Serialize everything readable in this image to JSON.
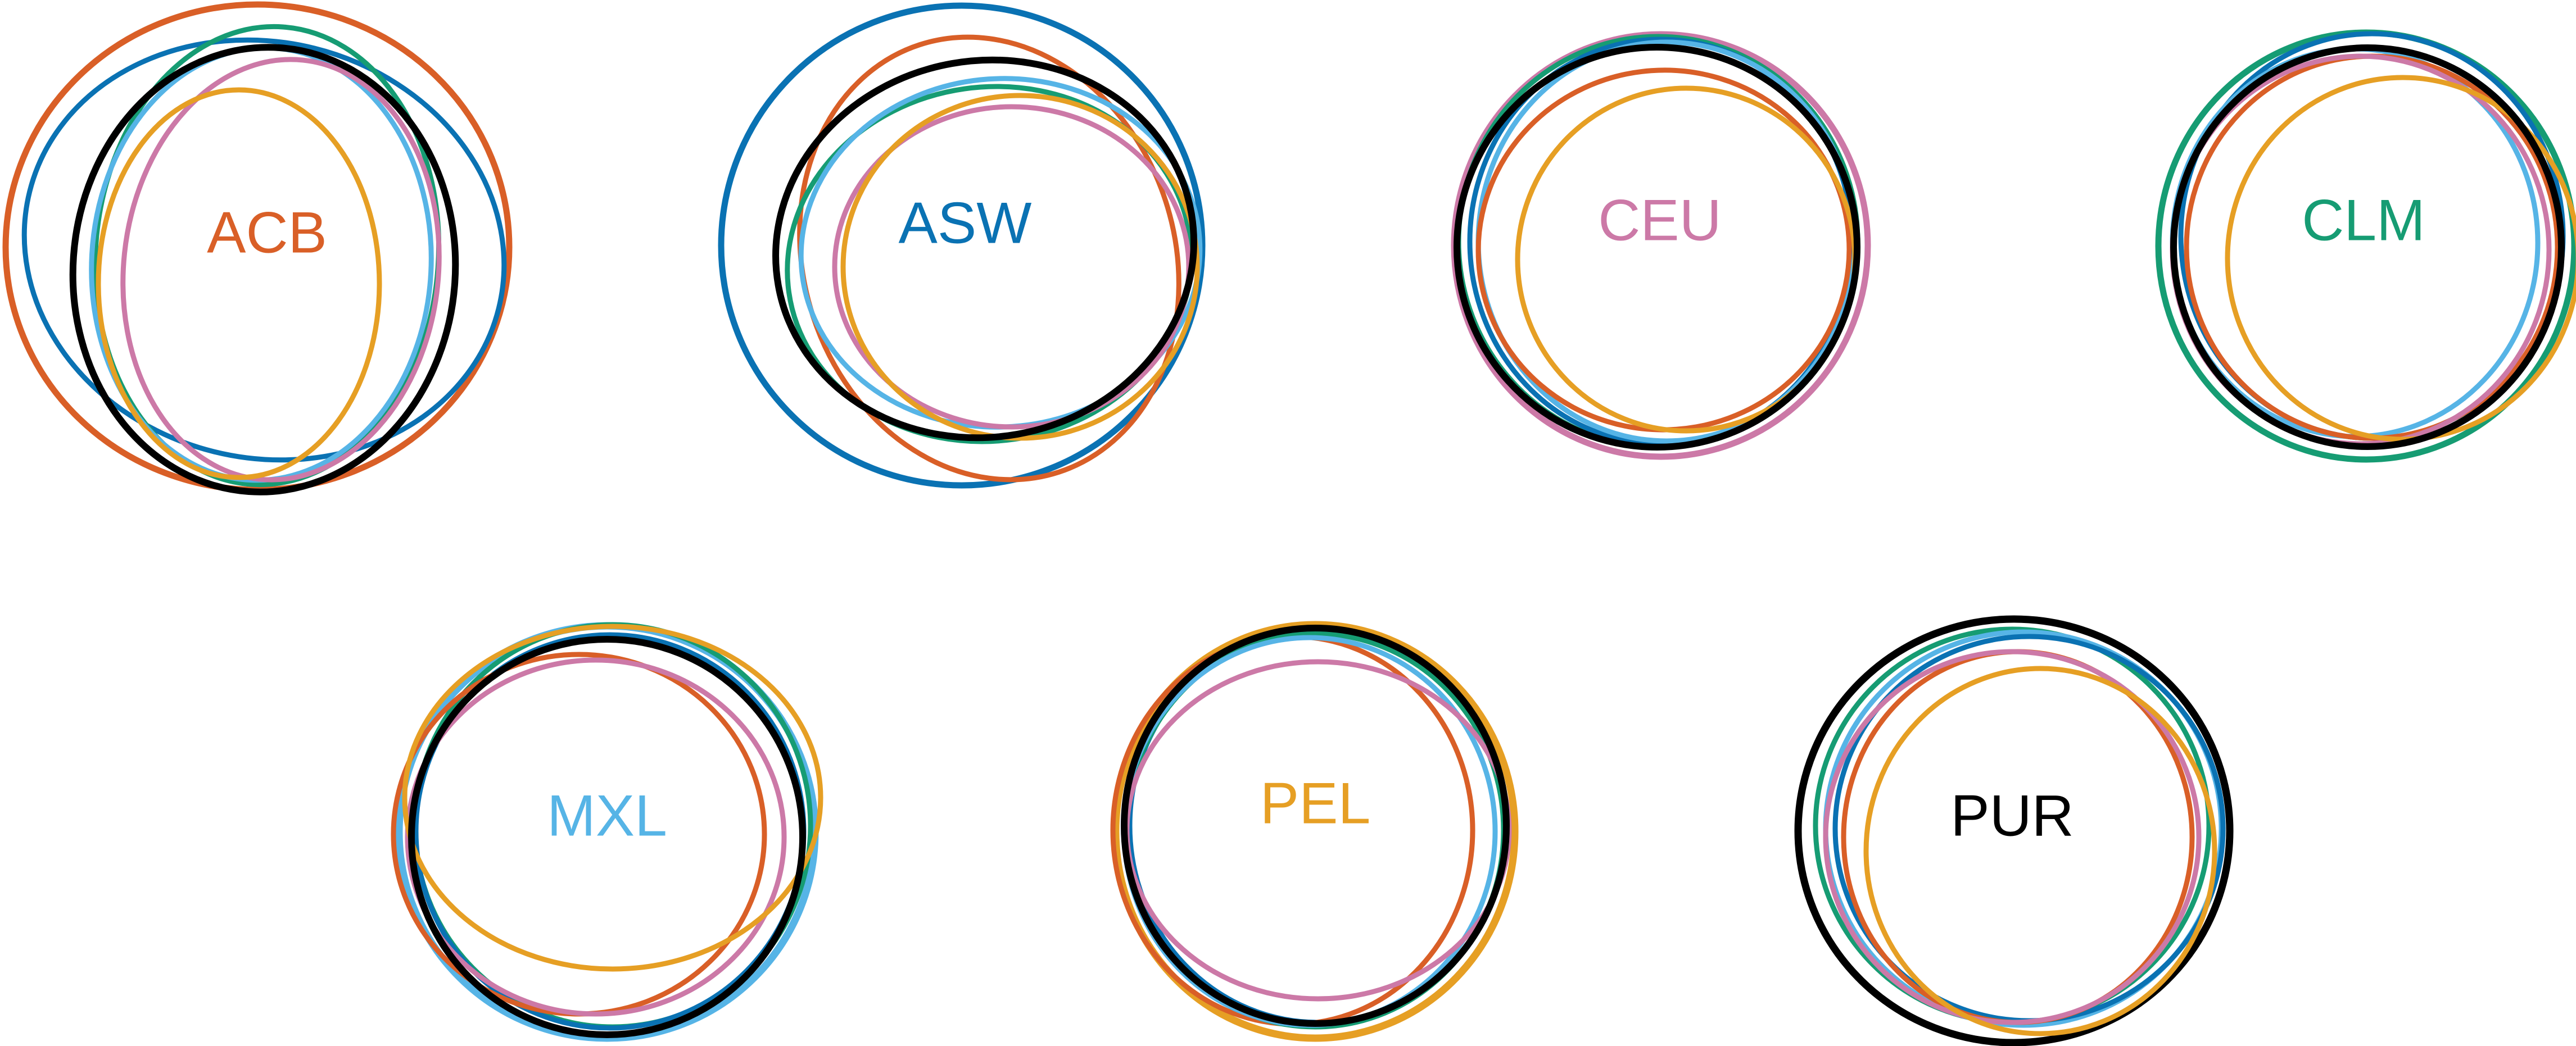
{
  "colors": {
    "ACB": "#d95f27",
    "ASW": "#0a72b3",
    "CEU": "#cc79a7",
    "CLM": "#169c73",
    "MXL": "#56b4e6",
    "PEL": "#e69f24",
    "PUR": "#000000"
  },
  "groups": [
    {
      "id": "ACB",
      "label": "ACB"
    },
    {
      "id": "ASW",
      "label": "ASW"
    },
    {
      "id": "CEU",
      "label": "CEU"
    },
    {
      "id": "CLM",
      "label": "CLM"
    },
    {
      "id": "MXL",
      "label": "MXL"
    },
    {
      "id": "PEL",
      "label": "PEL"
    },
    {
      "id": "PUR",
      "label": "PUR"
    }
  ]
}
